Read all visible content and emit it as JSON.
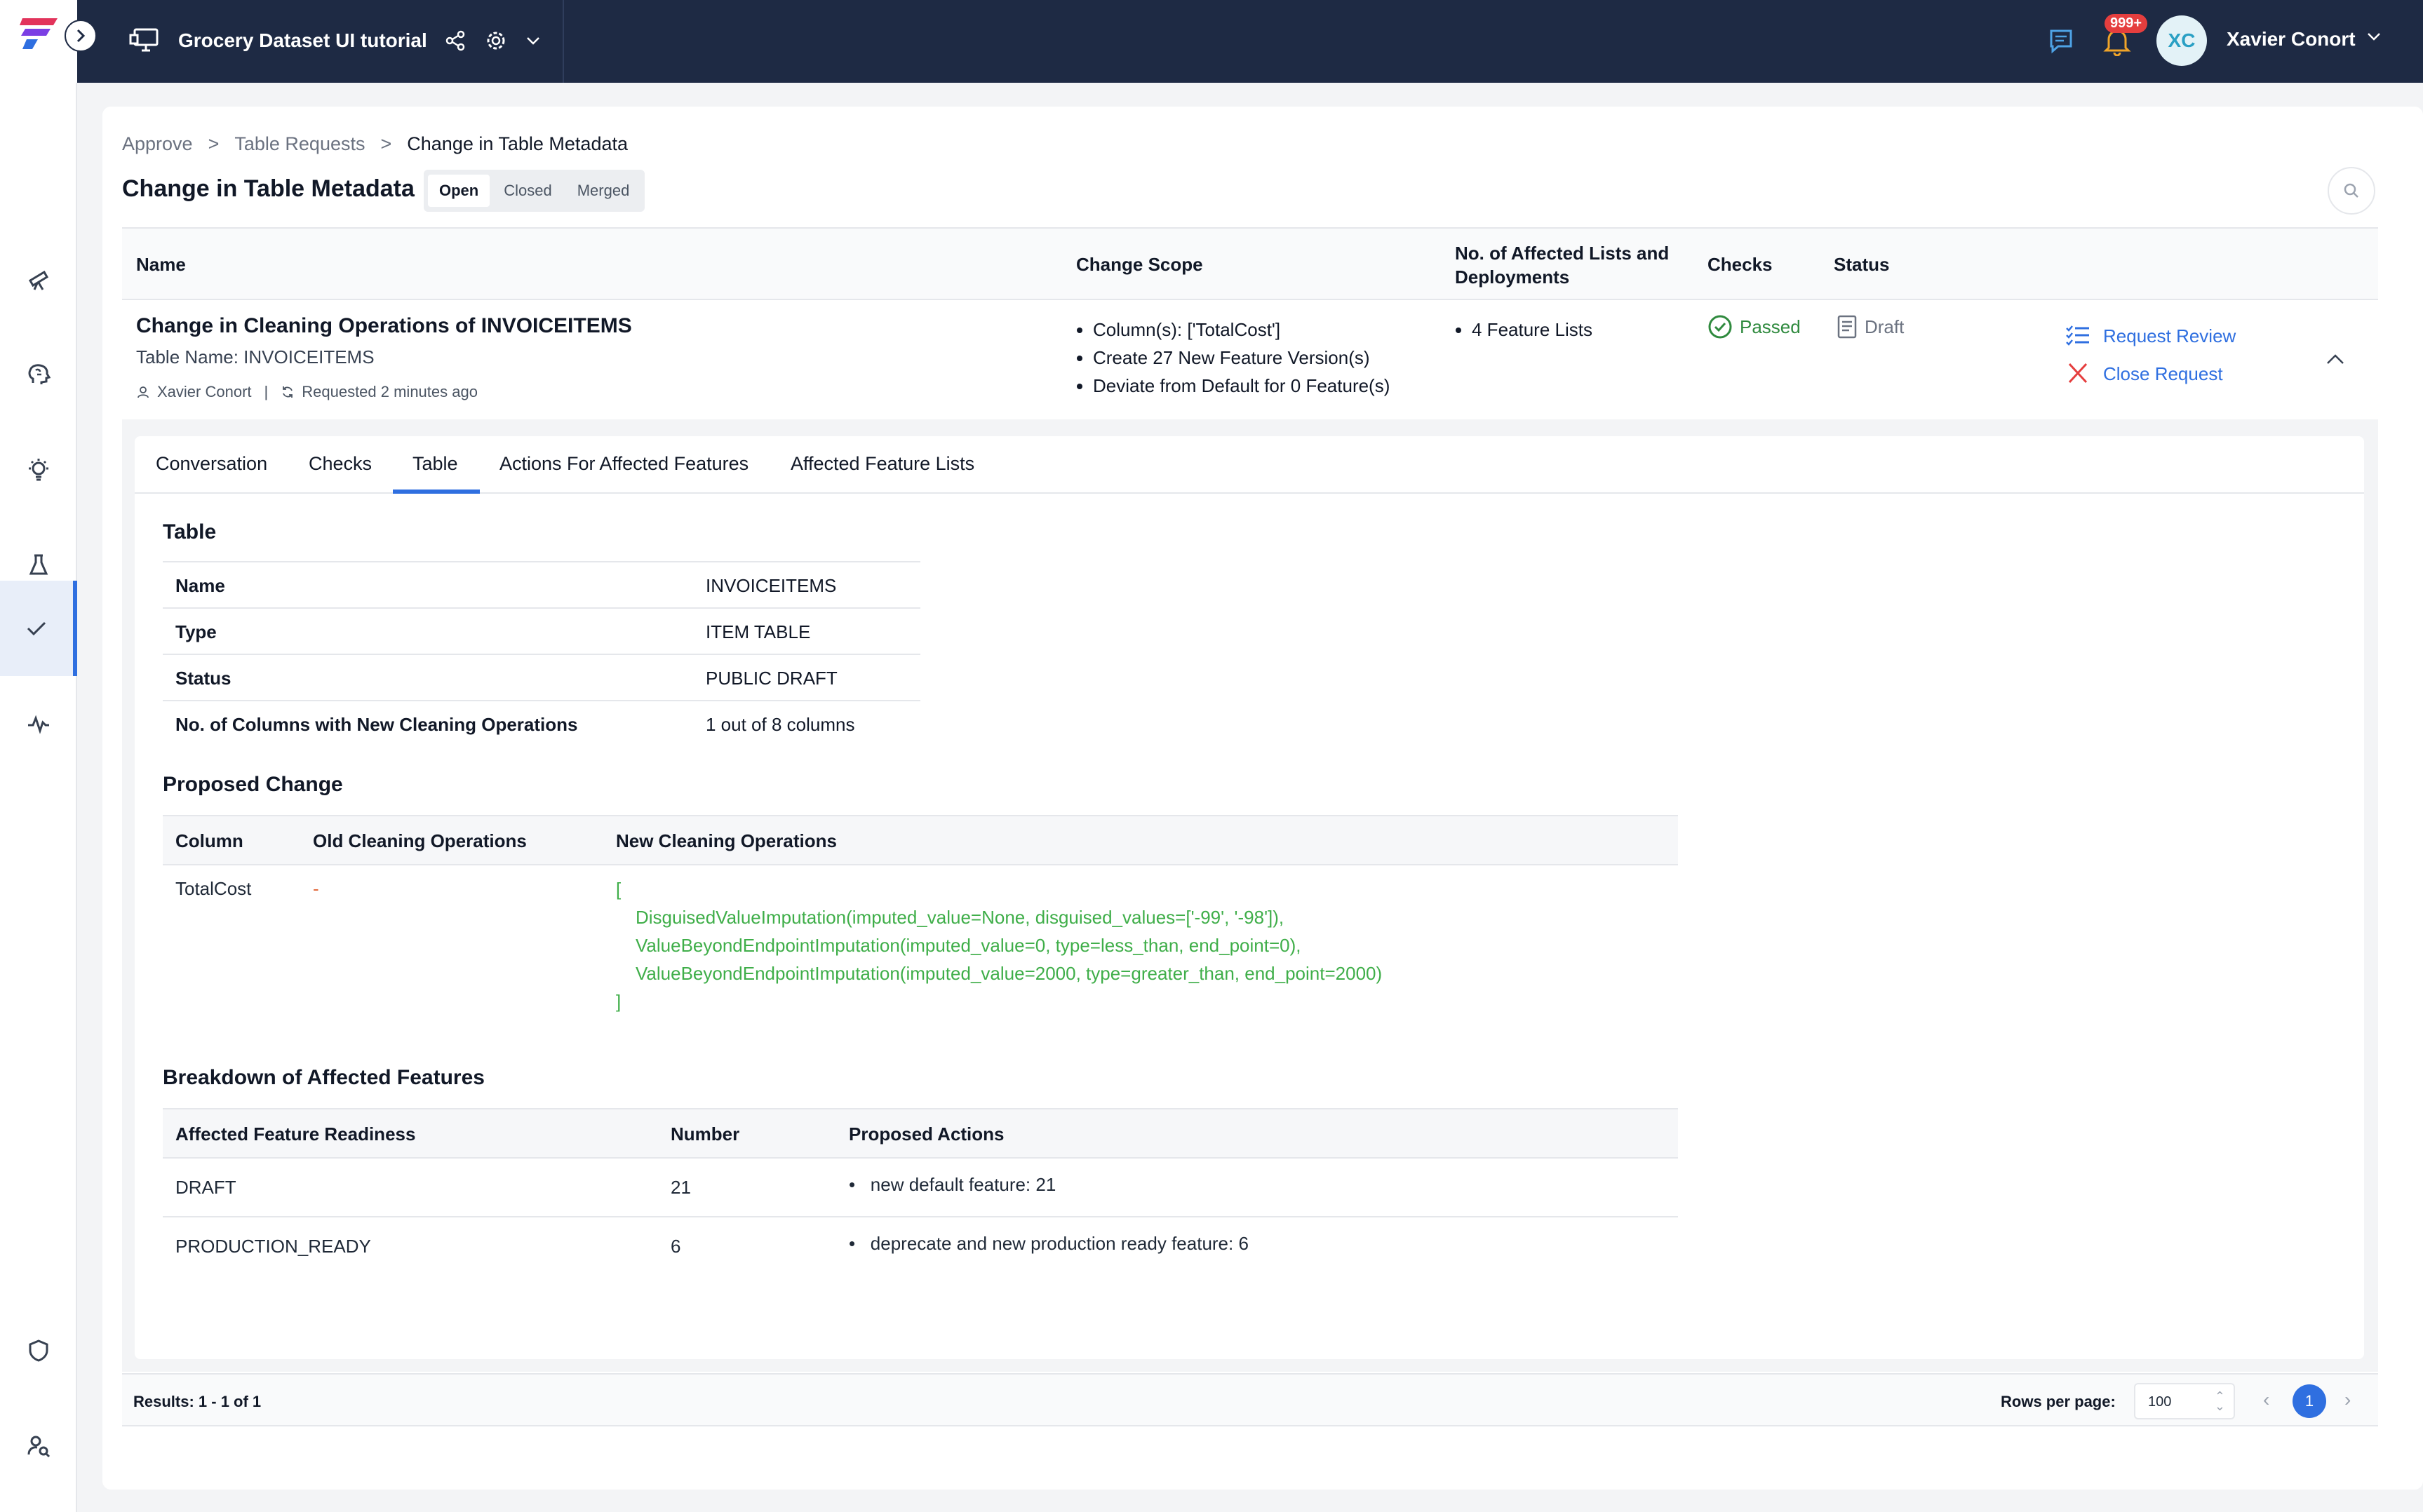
{
  "header": {
    "project_title": "Grocery Dataset UI tutorial",
    "notification_count": "999+",
    "user_initials": "XC",
    "user_name": "Xavier Conort"
  },
  "breadcrumb": {
    "items": [
      "Approve",
      "Table Requests",
      "Change in Table Metadata"
    ],
    "separator": ">"
  },
  "page": {
    "title": "Change in Table Metadata",
    "filter_tabs": [
      "Open",
      "Closed",
      "Merged"
    ],
    "active_filter": "Open"
  },
  "requests_table": {
    "columns": {
      "name": "Name",
      "scope": "Change Scope",
      "affected": "No. of Affected Lists and Deployments",
      "checks": "Checks",
      "status": "Status"
    },
    "row": {
      "name": "Change in Cleaning Operations of INVOICEITEMS",
      "table_name": "Table Name: INVOICEITEMS",
      "author": "Xavier Conort",
      "meta_separator": "|",
      "requested": "Requested 2 minutes ago",
      "scope": [
        "Column(s): ['TotalCost']",
        "Create 27 New Feature Version(s)",
        "Deviate from Default for 0 Feature(s)"
      ],
      "affected": [
        "4 Feature Lists"
      ],
      "checks": "Passed",
      "status": "Draft",
      "actions": {
        "review": "Request Review",
        "close": "Close Request"
      }
    }
  },
  "detail": {
    "tabs": [
      "Conversation",
      "Checks",
      "Table",
      "Actions For Affected Features",
      "Affected Feature Lists"
    ],
    "active_tab": "Table",
    "table_section": {
      "title": "Table",
      "rows": [
        {
          "key": "Name",
          "value": "INVOICEITEMS"
        },
        {
          "key": "Type",
          "value": "ITEM TABLE"
        },
        {
          "key": "Status",
          "value": "PUBLIC DRAFT"
        },
        {
          "key": "No. of Columns with New Cleaning Operations",
          "value": "1 out of 8 columns"
        }
      ]
    },
    "proposed_change": {
      "title": "Proposed Change",
      "headers": [
        "Column",
        "Old Cleaning Operations",
        "New Cleaning Operations"
      ],
      "row": {
        "column": "TotalCost",
        "old": "-",
        "new_lines": [
          "[",
          "DisguisedValueImputation(imputed_value=None, disguised_values=['-99', '-98']),",
          "ValueBeyondEndpointImputation(imputed_value=0, type=less_than, end_point=0),",
          "ValueBeyondEndpointImputation(imputed_value=2000, type=greater_than, end_point=2000)",
          "]"
        ]
      }
    },
    "breakdown": {
      "title": "Breakdown of Affected Features",
      "headers": [
        "Affected Feature Readiness",
        "Number",
        "Proposed Actions"
      ],
      "rows": [
        {
          "readiness": "DRAFT",
          "number": "21",
          "action": "new default feature: 21"
        },
        {
          "readiness": "PRODUCTION_READY",
          "number": "6",
          "action": "deprecate and new production ready feature: 6"
        }
      ]
    }
  },
  "footer": {
    "results": "Results: 1 - 1 of 1",
    "rows_per_page_label": "Rows per page:",
    "rows_per_page": "100",
    "current_page": "1"
  },
  "colors": {
    "topbar": "#1e2a44",
    "accent": "#2f6fe0",
    "passed": "#2f8a3e",
    "close": "#e53e3e",
    "code": "#3fae49"
  },
  "icons": [
    "logo-icon",
    "chevron-right-icon",
    "monitor-icon",
    "share-icon",
    "gear-icon",
    "chevron-down-icon",
    "chat-icon",
    "bell-icon",
    "telescope-icon",
    "brain-icon",
    "lightbulb-icon",
    "flask-icon",
    "check-icon",
    "pulse-icon",
    "shield-icon",
    "user-search-icon",
    "search-icon",
    "user-icon",
    "refresh-icon",
    "check-circle-icon",
    "document-icon",
    "list-check-icon",
    "close-icon",
    "chevron-up-icon"
  ]
}
